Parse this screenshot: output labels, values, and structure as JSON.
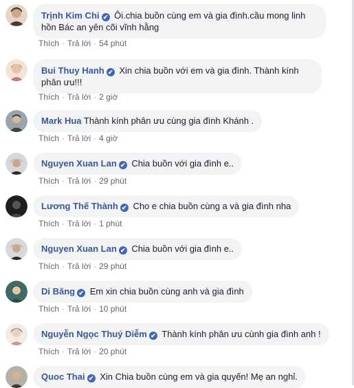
{
  "actions": {
    "like": "Thích",
    "reply": "Trả lời",
    "sep": "·"
  },
  "verified_icon": "✔",
  "comments": [
    {
      "author": "Trịnh Kim Chi",
      "verified": true,
      "text": "Ôi.chia buồn cùng em và gia đình.cầu mong linh hồn Bác an yên cõi vĩnh hằng",
      "time": "54 phút",
      "avatar_colors": [
        "#c9a98a",
        "#4a3a30"
      ]
    },
    {
      "author": "Bui Thuy Hanh",
      "verified": true,
      "text": "Xin chia buồn với em và gia đình. Thành kính phân ưu!!!",
      "time": "2 giờ",
      "avatar_colors": [
        "#e9c2a8",
        "#8a5a40"
      ]
    },
    {
      "author": "Mark Hua",
      "verified": false,
      "text": "Thành kính phân ưu cùng gia đình Khánh .",
      "time": "4 giờ",
      "avatar_colors": [
        "#9aa4ae",
        "#3d4348"
      ]
    },
    {
      "author": "Nguyen Xuan Lan",
      "verified": true,
      "text": "Chia buồn với gia đình e..",
      "time": "29 phút",
      "avatar_colors": [
        "#d8d8d8",
        "#2a2a2a"
      ]
    },
    {
      "author": "Lương Thế Thành",
      "verified": true,
      "text": "Cho e chia buồn cùng a và gia đình nha",
      "time": "1 phút",
      "avatar_colors": [
        "#555555",
        "#1e1e1e"
      ]
    },
    {
      "author": "Nguyen Xuan Lan",
      "verified": true,
      "text": "Chia buồn với gia đình e..",
      "time": "29 phút",
      "avatar_colors": [
        "#d8d8d8",
        "#2a2a2a"
      ]
    },
    {
      "author": "Di Băng",
      "verified": true,
      "text": "Em xin chia buồn cùng anh và gia đình",
      "time": "10 phút",
      "avatar_colors": [
        "#3f6b6a",
        "#e0c9a0"
      ]
    },
    {
      "author": "Nguyễn Ngọc Thuý Diễm",
      "verified": true,
      "text": "Thành kính phân ưu cùnh gia đình anh !",
      "time": "20 phút",
      "avatar_colors": [
        "#e6d2c0",
        "#6a4a3a"
      ]
    },
    {
      "author": "Quoc Thai",
      "verified": true,
      "text": "Xin Chia buồn cùng em và gia quyến! Mẹ an nghỉ.",
      "time": "",
      "avatar_colors": [
        "#b8b0a4",
        "#3a3630"
      ]
    }
  ]
}
